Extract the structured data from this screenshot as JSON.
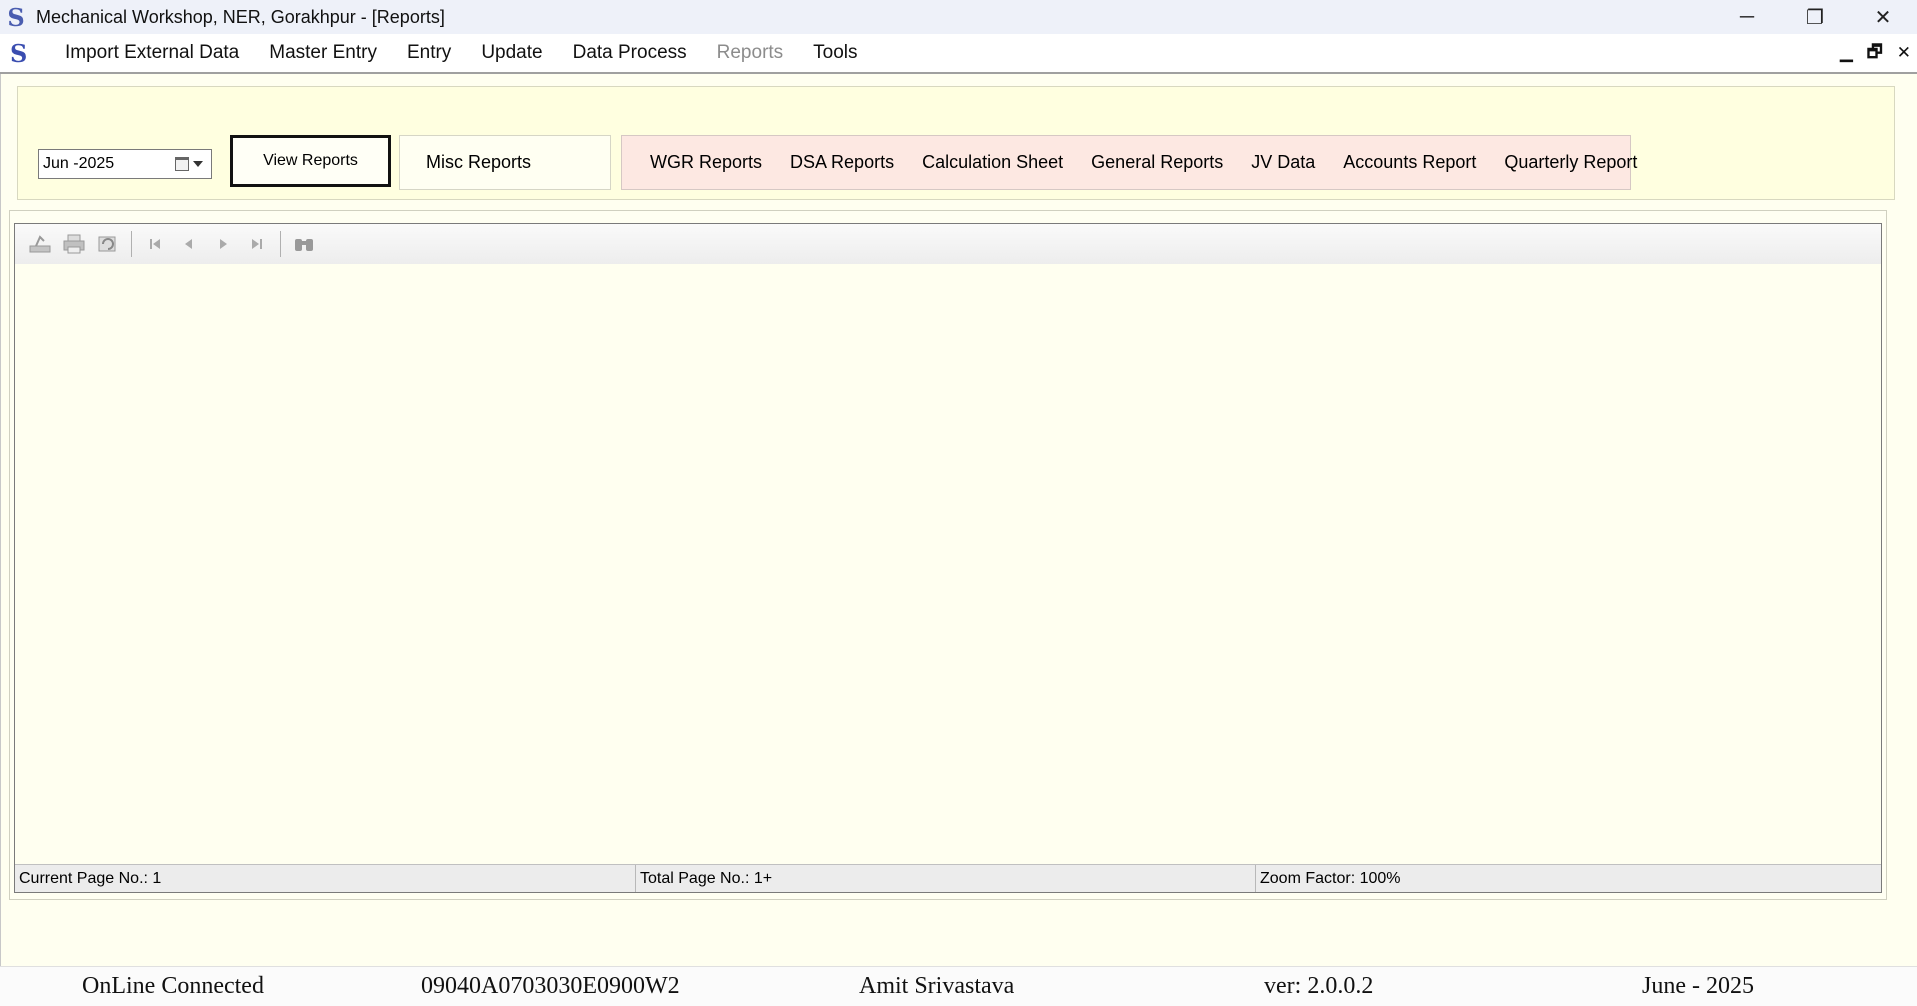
{
  "window": {
    "title": "Mechanical Workshop, NER, Gorakhpur - [Reports]",
    "logo_letter": "S",
    "controls": {
      "minimize": "─",
      "restore": "❐",
      "close": "✕"
    }
  },
  "menu": {
    "logo_letter": "S",
    "items": [
      {
        "label": "Import External Data"
      },
      {
        "label": "Master Entry"
      },
      {
        "label": "Entry"
      },
      {
        "label": "Update"
      },
      {
        "label": "Data Process"
      },
      {
        "label": "Reports",
        "disabled": true
      },
      {
        "label": "Tools"
      }
    ],
    "mdi_controls": {
      "minimize": "▁",
      "restore": "🗗",
      "close": "✕"
    }
  },
  "filters": {
    "month_value": "Jun -2025",
    "view_button": "View Reports",
    "misc_reports": "Misc Reports",
    "report_buttons": [
      "WGR Reports",
      "DSA Reports",
      "Calculation Sheet",
      "General Reports",
      "JV Data",
      "Accounts Report",
      "Quarterly Report"
    ]
  },
  "viewer": {
    "toolbar_icons": [
      "export-icon",
      "print-icon",
      "refresh-icon",
      "first-page-icon",
      "prev-page-icon",
      "next-page-icon",
      "last-page-icon",
      "find-icon"
    ],
    "status": {
      "current_page": "Current Page No.: 1",
      "total_page": "Total Page No.: 1+",
      "zoom": "Zoom Factor: 100%"
    }
  },
  "app_status": {
    "connection": "OnLine Connected",
    "code": "09040A0703030E0900W2",
    "user": "Amit Srivastava",
    "version": "ver: 2.0.0.2",
    "period": "June - 2025"
  },
  "colors": {
    "workspace_bg": "#fffff0",
    "filter_panel_bg": "#ffffe0",
    "reports_panel_bg": "#fde8e2",
    "logo": "#4a5db0"
  }
}
